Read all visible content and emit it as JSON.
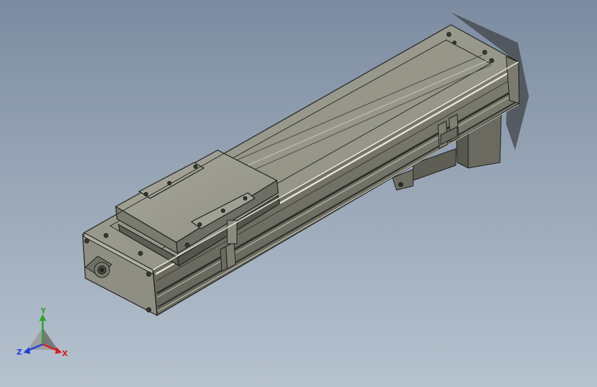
{
  "view": {
    "background_top": "#7c8ba0",
    "background_bottom": "#b7c2cf",
    "part_color": "#8a8a7e",
    "edge_color": "#1e1e1c"
  },
  "triad": {
    "y_label": "Y",
    "z_label": "Z",
    "x_label": "X",
    "y_color": "#2aa52a",
    "x_color": "#d42020",
    "z_color": "#2040d8"
  }
}
